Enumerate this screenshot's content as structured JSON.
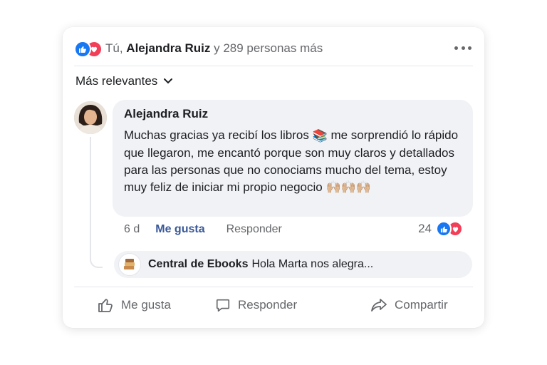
{
  "reactions": {
    "summary_prefix": "Tú, ",
    "summary_name": "Alejandra Ruiz",
    "summary_suffix": " y 289 personas más",
    "icons": [
      "like-icon",
      "love-icon"
    ]
  },
  "sort": {
    "label": "Más relevantes"
  },
  "comment": {
    "author": "Alejandra Ruiz",
    "text_part1": "Muchas gracias ya recibí los libros ",
    "emoji_books": "📚",
    "text_part2": " me sorprendió lo rápido que llegaron, me encantó porque son muy claros y detallados para las personas que no conociams mucho del tema, estoy muy feliz de iniciar mi propio negocio ",
    "emoji_hands": "🙌🏼🙌🏼🙌🏼",
    "age": "6 d",
    "like_label": "Me gusta",
    "reply_label": "Responder",
    "reaction_count": "24"
  },
  "reply": {
    "author": "Central de Ebooks",
    "preview": "Hola Marta nos alegra..."
  },
  "footer": {
    "like": "Me gusta",
    "reply": "Responder",
    "share": "Compartir"
  },
  "colors": {
    "like": "#1877f2",
    "love": "#f33e58",
    "link": "#385898"
  }
}
